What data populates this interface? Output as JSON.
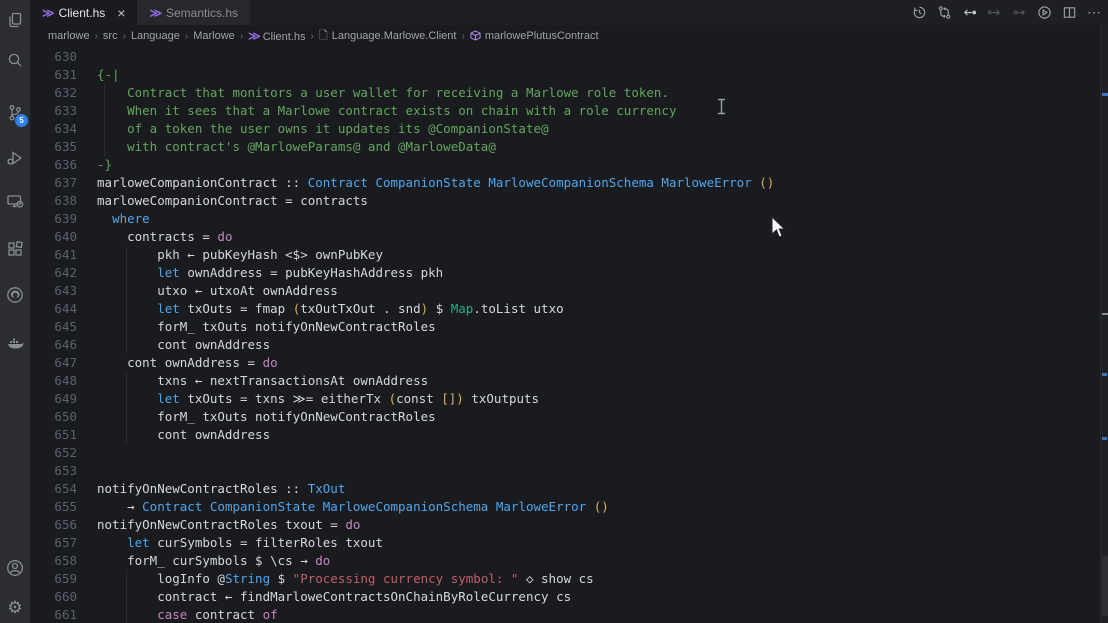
{
  "colors": {
    "bg": "#1a1b1f",
    "fg": "#d4d7dd",
    "comment": "#63a45e",
    "keyword": "#4fa6ed",
    "magenta": "#c586c0",
    "yellow": "#d8b05c",
    "string": "#be6069",
    "teal": "#2bab83",
    "badge": "#2f7fe8",
    "purple": "#8f67d8"
  },
  "activity_bar": {
    "items": [
      {
        "name": "explorer",
        "icon": "files-icon"
      },
      {
        "name": "search",
        "icon": "search-icon"
      },
      {
        "name": "source-control",
        "icon": "git-branch-icon",
        "badge": "5"
      },
      {
        "name": "run-and-debug",
        "icon": "debug-icon"
      },
      {
        "name": "remote-explorer",
        "icon": "remote-monitor-icon"
      },
      {
        "name": "extensions",
        "icon": "extensions-icon"
      },
      {
        "name": "github",
        "icon": "github-icon"
      },
      {
        "name": "docker",
        "icon": "docker-whale-icon"
      },
      {
        "name": "account",
        "icon": "account-icon"
      },
      {
        "name": "settings",
        "icon": "gear-icon",
        "glyph": "⚙"
      }
    ]
  },
  "tabs": [
    {
      "label": "Client.hs",
      "active": true,
      "close": "×",
      "icon": "haskell-icon",
      "icon_glyph": "≫"
    },
    {
      "label": "Semantics.hs",
      "active": false,
      "icon": "haskell-icon",
      "icon_glyph": "≫"
    }
  ],
  "editor_actions": [
    "history-icon",
    "git-compare-icon",
    "navigate-back-icon",
    "navigate-forward-icon",
    "navigate-forward-alt-icon",
    "run-icon",
    "split-editor-icon",
    "more-actions-icon"
  ],
  "more_actions_glyph": "⋯",
  "breadcrumbs": {
    "sep": "›",
    "items": [
      {
        "label": "marlowe"
      },
      {
        "label": "src"
      },
      {
        "label": "Language"
      },
      {
        "label": "Marlowe"
      },
      {
        "label": "Client.hs",
        "icon": "haskell-icon",
        "icon_glyph": "≫"
      },
      {
        "label": "Language.Marlowe.Client",
        "icon": "file-icon",
        "icon_glyph": "🗋"
      },
      {
        "label": "marlowePlutusContract",
        "icon": "symbol-icon"
      }
    ]
  },
  "editor": {
    "lines": [
      {
        "n": 630,
        "t": []
      },
      {
        "n": 631,
        "t": [
          [
            "c",
            "{-|"
          ]
        ]
      },
      {
        "n": 632,
        "t": [
          [
            "c",
            "    Contract that monitors a user wallet for receiving a Marlowe role token."
          ]
        ]
      },
      {
        "n": 633,
        "t": [
          [
            "c",
            "    When it sees that a Marlowe contract exists on chain with a role currency"
          ]
        ]
      },
      {
        "n": 634,
        "t": [
          [
            "c",
            "    of a token the user owns it updates its @CompanionState@"
          ]
        ]
      },
      {
        "n": 635,
        "t": [
          [
            "c",
            "    with contract's @MarloweParams@ and @MarloweData@"
          ]
        ]
      },
      {
        "n": 636,
        "t": [
          [
            "c",
            "-}"
          ]
        ]
      },
      {
        "n": 637,
        "t": [
          [
            "p",
            "marloweCompanionContract :: "
          ],
          [
            "b",
            "Contract CompanionState MarloweCompanionSchema MarloweError "
          ],
          [
            "y",
            "()"
          ]
        ]
      },
      {
        "n": 638,
        "t": [
          [
            "p",
            "marloweCompanionContract = contracts"
          ]
        ]
      },
      {
        "n": 639,
        "t": [
          [
            "p",
            "  "
          ],
          [
            "b",
            "where"
          ]
        ]
      },
      {
        "n": 640,
        "t": [
          [
            "p",
            "    contracts = "
          ],
          [
            "m",
            "do"
          ]
        ]
      },
      {
        "n": 641,
        "t": [
          [
            "p",
            "        pkh ← pubKeyHash <$> ownPubKey"
          ]
        ]
      },
      {
        "n": 642,
        "t": [
          [
            "p",
            "        "
          ],
          [
            "b",
            "let"
          ],
          [
            "p",
            " ownAddress = pubKeyHashAddress pkh"
          ]
        ]
      },
      {
        "n": 643,
        "t": [
          [
            "p",
            "        utxo ← utxoAt ownAddress"
          ]
        ]
      },
      {
        "n": 644,
        "t": [
          [
            "p",
            "        "
          ],
          [
            "b",
            "let"
          ],
          [
            "p",
            " txOuts = fmap "
          ],
          [
            "y",
            "("
          ],
          [
            "p",
            "txOutTxOut . snd"
          ],
          [
            "y",
            ")"
          ],
          [
            "p",
            " $ "
          ],
          [
            "g",
            "Map"
          ],
          [
            "p",
            ".toList utxo"
          ]
        ]
      },
      {
        "n": 645,
        "t": [
          [
            "p",
            "        forM_ txOuts notifyOnNewContractRoles"
          ]
        ]
      },
      {
        "n": 646,
        "t": [
          [
            "p",
            "        cont ownAddress"
          ]
        ]
      },
      {
        "n": 647,
        "t": [
          [
            "p",
            "    cont ownAddress = "
          ],
          [
            "m",
            "do"
          ]
        ]
      },
      {
        "n": 648,
        "t": [
          [
            "p",
            "        txns ← nextTransactionsAt ownAddress"
          ]
        ]
      },
      {
        "n": 649,
        "t": [
          [
            "p",
            "        "
          ],
          [
            "b",
            "let"
          ],
          [
            "p",
            " txOuts = txns ≫= eitherTx "
          ],
          [
            "y",
            "("
          ],
          [
            "p",
            "const "
          ],
          [
            "y",
            "[])"
          ],
          [
            "p",
            " txOutputs"
          ]
        ]
      },
      {
        "n": 650,
        "t": [
          [
            "p",
            "        forM_ txOuts notifyOnNewContractRoles"
          ]
        ]
      },
      {
        "n": 651,
        "t": [
          [
            "p",
            "        cont ownAddress"
          ]
        ]
      },
      {
        "n": 652,
        "t": []
      },
      {
        "n": 653,
        "t": []
      },
      {
        "n": 654,
        "t": [
          [
            "p",
            "notifyOnNewContractRoles :: "
          ],
          [
            "b",
            "TxOut"
          ]
        ]
      },
      {
        "n": 655,
        "t": [
          [
            "p",
            "    → "
          ],
          [
            "b",
            "Contract CompanionState MarloweCompanionSchema MarloweError "
          ],
          [
            "y",
            "()"
          ]
        ]
      },
      {
        "n": 656,
        "t": [
          [
            "p",
            "notifyOnNewContractRoles txout = "
          ],
          [
            "m",
            "do"
          ]
        ]
      },
      {
        "n": 657,
        "t": [
          [
            "p",
            "    "
          ],
          [
            "b",
            "let"
          ],
          [
            "p",
            " curSymbols = filterRoles txout"
          ]
        ]
      },
      {
        "n": 658,
        "t": [
          [
            "p",
            "    forM_ curSymbols $ \\cs → "
          ],
          [
            "m",
            "do"
          ]
        ]
      },
      {
        "n": 659,
        "t": [
          [
            "p",
            "        logInfo @"
          ],
          [
            "b",
            "String"
          ],
          [
            "p",
            " $ "
          ],
          [
            "s",
            "\"Processing currency symbol: \""
          ],
          [
            "p",
            " ◇ show cs"
          ]
        ]
      },
      {
        "n": 660,
        "t": [
          [
            "p",
            "        contract ← findMarloweContractsOnChainByRoleCurrency cs"
          ]
        ]
      },
      {
        "n": 661,
        "t": [
          [
            "p",
            "        "
          ],
          [
            "m",
            "case"
          ],
          [
            "p",
            " contract "
          ],
          [
            "m",
            "of"
          ]
        ]
      }
    ]
  }
}
